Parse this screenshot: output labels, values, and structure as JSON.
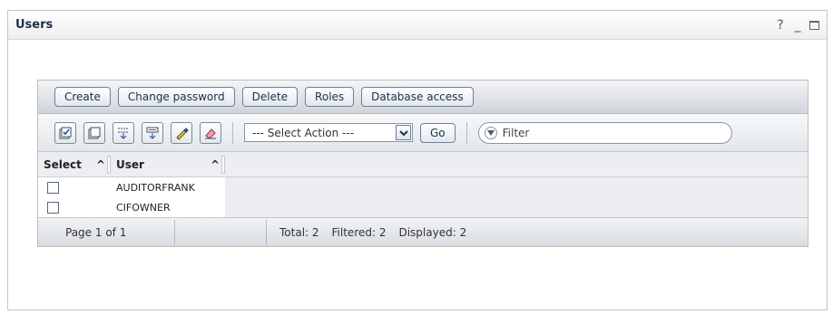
{
  "portlet": {
    "title": "Users",
    "help_label": "?",
    "minimize_label": "_"
  },
  "actions": {
    "create": "Create",
    "change_password": "Change password",
    "delete": "Delete",
    "roles": "Roles",
    "database_access": "Database access"
  },
  "toolbar": {
    "icons": [
      "select-all-icon",
      "deselect-all-icon",
      "expand-all-icon",
      "collapse-all-icon",
      "edit-sort-icon",
      "clear-sort-icon"
    ],
    "select_action": "--- Select Action ---",
    "go_label": "Go",
    "filter_placeholder": "Filter"
  },
  "table": {
    "columns": [
      "Select",
      "User"
    ],
    "sort_glyph": "^",
    "rows": [
      {
        "user": "AUDITORFRANK"
      },
      {
        "user": "CIFOWNER"
      }
    ]
  },
  "footer": {
    "page": "Page 1 of 1",
    "total": "Total: 2",
    "filtered": "Filtered: 2",
    "displayed": "Displayed: 2"
  }
}
